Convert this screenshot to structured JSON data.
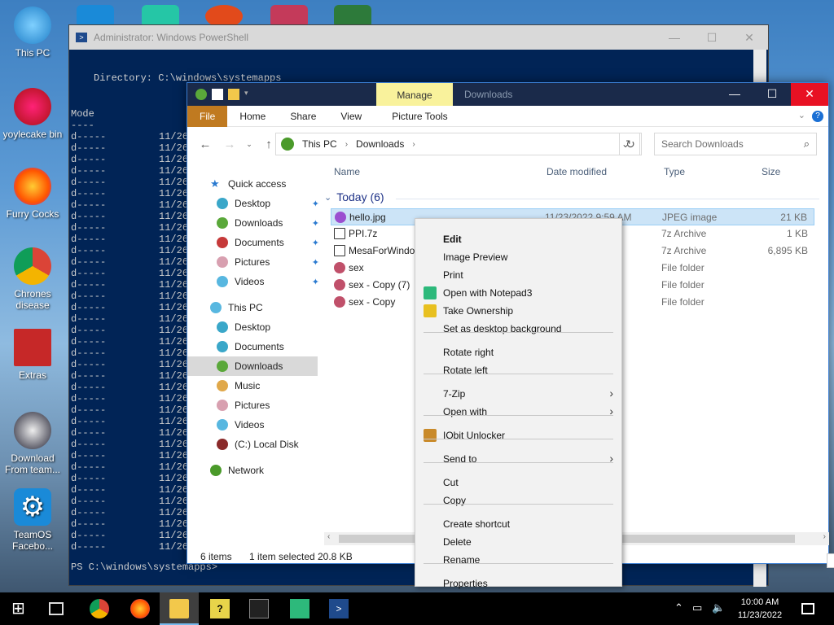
{
  "desktop": {
    "icons": [
      {
        "label": "This PC",
        "icon": "monitor-icon",
        "color": "#3aa0e6"
      },
      {
        "label": "yoylecake bin",
        "icon": "recycle-bin-icon",
        "color": "#c02a2a"
      },
      {
        "label": "Furry Cocks",
        "icon": "firefox-icon",
        "color": "#ff7a1a"
      },
      {
        "label": "Chrones disease",
        "icon": "chrome-icon",
        "color": "#4caf50"
      },
      {
        "label": "Extras",
        "icon": "box-icon",
        "color": "#d33"
      },
      {
        "label": "Download From team...",
        "icon": "download-icon",
        "color": "#223"
      },
      {
        "label": "TeamOS Facebo...",
        "icon": "gear-icon",
        "color": "#1a8ad8"
      }
    ]
  },
  "powershell": {
    "title": "Administrator: Windows PowerShell",
    "directory_line": "Directory: C:\\windows\\systemapps",
    "mode_header": "Mode",
    "mode_underline": "----",
    "row_mode": "d-----",
    "row_date": "11/26/",
    "prompt": "PS C:\\windows\\systemapps>"
  },
  "explorer": {
    "manage_tab": "Manage",
    "title": "Downloads",
    "ribbon_tabs": [
      "File",
      "Home",
      "Share",
      "View",
      "Picture Tools"
    ],
    "address": {
      "segments": [
        "This PC",
        "Downloads"
      ]
    },
    "search_placeholder": "Search Downloads",
    "nav": {
      "quick_access": "Quick access",
      "quick_items": [
        "Desktop",
        "Downloads",
        "Documents",
        "Pictures",
        "Videos"
      ],
      "this_pc": "This PC",
      "pc_items": [
        "Desktop",
        "Documents",
        "Downloads",
        "Music",
        "Pictures",
        "Videos",
        "(C:) Local Disk"
      ],
      "network": "Network"
    },
    "columns": [
      "Name",
      "Date modified",
      "Type",
      "Size"
    ],
    "group_label": "Today (6)",
    "files": [
      {
        "name": "hello.jpg",
        "date": "11/23/2022 9:59 AM",
        "type": "JPEG image",
        "size": "21 KB",
        "icon": "image-file-icon"
      },
      {
        "name": "PPI.7z",
        "date": "M",
        "type": "7z Archive",
        "size": "1 KB",
        "icon": "archive-icon"
      },
      {
        "name": "MesaForWindo",
        "date": "M",
        "type": "7z Archive",
        "size": "6,895 KB",
        "icon": "archive-icon"
      },
      {
        "name": "sex",
        "date": "M",
        "type": "File folder",
        "size": "",
        "icon": "folder-icon"
      },
      {
        "name": "sex - Copy (7)",
        "date": "M",
        "type": "File folder",
        "size": "",
        "icon": "folder-icon"
      },
      {
        "name": "sex - Copy",
        "date": "M",
        "type": "File folder",
        "size": "",
        "icon": "folder-icon"
      }
    ],
    "status": {
      "items": "6 items",
      "selected": "1 item selected",
      "size": "20.8 KB"
    }
  },
  "context_menu": {
    "items": [
      {
        "label": "Edit",
        "bold": true
      },
      {
        "label": "Image Preview"
      },
      {
        "label": "Print"
      },
      {
        "label": "Open with Notepad3",
        "icon": "notepad3-icon"
      },
      {
        "label": "Take Ownership",
        "icon": "shield-icon"
      },
      {
        "label": "Set as desktop background"
      },
      {
        "label": "Rotate right"
      },
      {
        "label": "Rotate left"
      },
      {
        "label": "7-Zip",
        "submenu": true
      },
      {
        "label": "Open with",
        "submenu": true
      },
      {
        "label": "IObit Unlocker",
        "icon": "unlocker-icon"
      },
      {
        "label": "Send to",
        "submenu": true
      },
      {
        "label": "Cut"
      },
      {
        "label": "Copy"
      },
      {
        "label": "Create shortcut"
      },
      {
        "label": "Delete"
      },
      {
        "label": "Rename"
      },
      {
        "label": "Properties"
      }
    ]
  },
  "taskbar": {
    "time": "10:00 AM",
    "date": "11/23/2022"
  },
  "colors": {
    "accent": "#0078d7",
    "close_red": "#e81123",
    "ps_blue": "#012456",
    "manage_yellow": "#f9f29c"
  }
}
